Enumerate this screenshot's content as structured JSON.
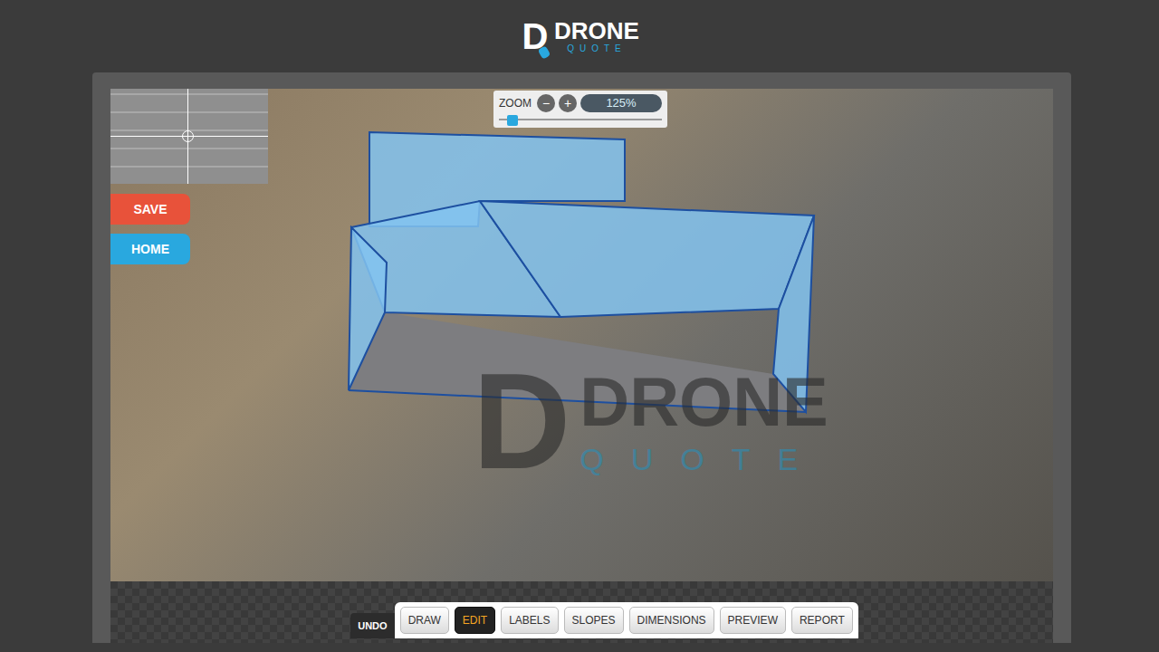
{
  "header": {
    "logo": {
      "letter": "D",
      "word": "DRONE",
      "sub": "QUOTE"
    }
  },
  "zoom": {
    "label": "ZOOM",
    "minus": "−",
    "plus": "+",
    "value": "125%",
    "level": 0.05
  },
  "side_buttons": [
    {
      "label": "SAVE",
      "color": "#e8523a"
    },
    {
      "label": "HOME",
      "color": "#29a8df"
    }
  ],
  "watermark": {
    "letter": "D",
    "word": "DRONE",
    "sub": "QUOTE"
  },
  "toolbar": {
    "undo": "UNDO",
    "buttons": [
      {
        "label": "DRAW",
        "selected": false
      },
      {
        "label": "EDIT",
        "selected": true
      },
      {
        "label": "LABELS",
        "selected": false
      },
      {
        "label": "SLOPES",
        "selected": false
      },
      {
        "label": "DIMENSIONS",
        "selected": false
      },
      {
        "label": "PREVIEW",
        "selected": false
      },
      {
        "label": "REPORT",
        "selected": false
      }
    ]
  }
}
